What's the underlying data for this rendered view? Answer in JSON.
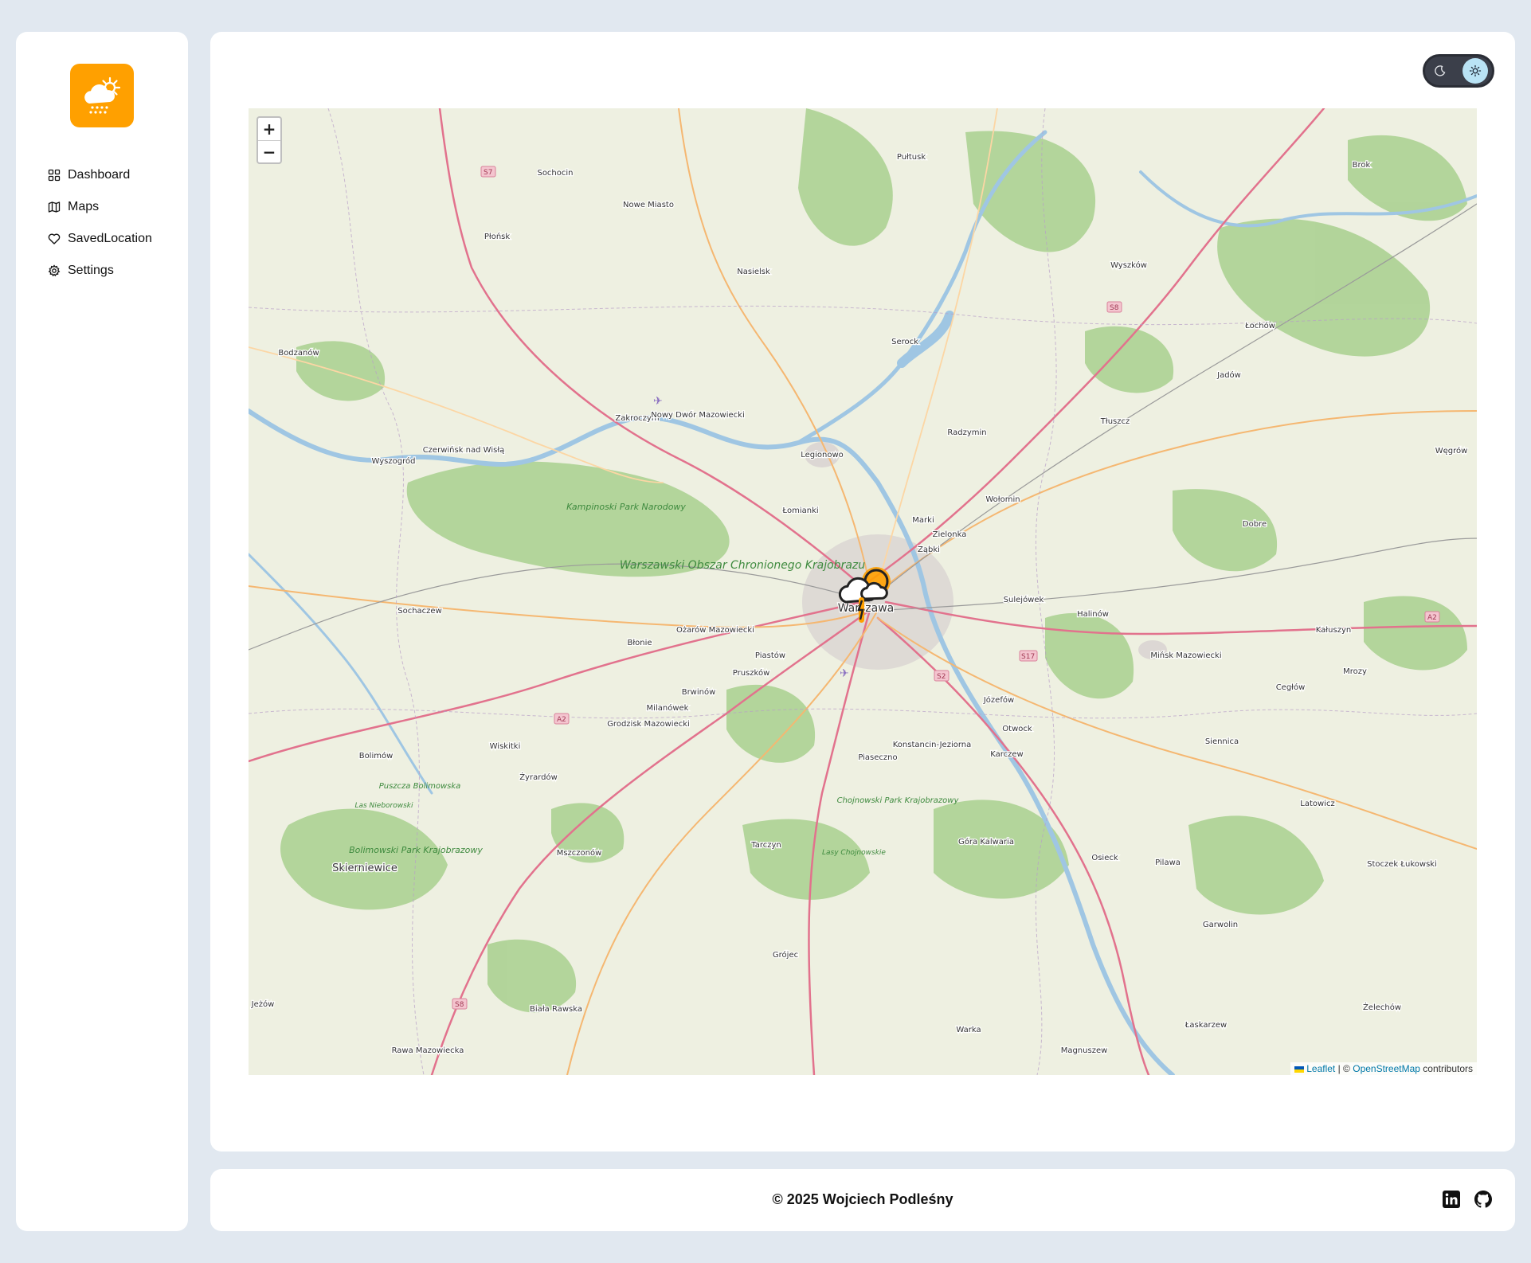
{
  "sidebar": {
    "items": [
      {
        "label": "Dashboard",
        "icon": "grid-icon"
      },
      {
        "label": "Maps",
        "icon": "map-icon"
      },
      {
        "label": "SavedLocation",
        "icon": "heart-icon"
      },
      {
        "label": "Settings",
        "icon": "gear-icon"
      }
    ]
  },
  "map": {
    "zoom_in": "+",
    "zoom_out": "−",
    "attribution": {
      "leaflet": "Leaflet",
      "separator": "| ©",
      "osm": "OpenStreetMap",
      "suffix": "contributors"
    },
    "places": [
      "Pułtusk",
      "Sochocin",
      "Nowe Miasto",
      "Płońsk",
      "Nasielsk",
      "Wyszków",
      "Brok",
      "Łochów",
      "Jadów",
      "Serock",
      "Bodzanów",
      "Zakroczym",
      "Nowy Dwór Mazowiecki",
      "Radzymin",
      "Tłuszcz",
      "Legionowo",
      "Wyszogród",
      "Czerwińsk nad Wisłą",
      "Węgrów",
      "Wołomin",
      "Łomianki",
      "Marki",
      "Zielonka",
      "Ząbki",
      "Dobre",
      "Warszawa",
      "Sochaczew",
      "Sulejówek",
      "Halinów",
      "Kałuszyn",
      "Błonie",
      "Ożarów Mazowiecki",
      "Piastów",
      "Pruszków",
      "Mińsk Mazowiecki",
      "Mrozy",
      "Brwinów",
      "Cegłów",
      "Józefów",
      "Milanówek",
      "Grodzisk Mazowiecki",
      "Otwock",
      "Konstancin-Jeziorna",
      "Piaseczno",
      "Karczew",
      "Siennica",
      "Bolimów",
      "Wiskitki",
      "Żyrardów",
      "Latowicz",
      "Mszczonów",
      "Tarczyn",
      "Góra Kalwaria",
      "Osieck",
      "Pilawa",
      "Skierniewice",
      "Stoczek Łukowski",
      "Garwolin",
      "Grójec",
      "Jeżów",
      "Biała Rawska",
      "Żelechów",
      "Łaskarzew",
      "Warka",
      "Rawa Mazowiecka",
      "Magnuszew"
    ],
    "areas": [
      "Kampinoski Park Narodowy",
      "Warszawski Obszar Chronionego Krajobrazu",
      "Bolimowski Park Krajobrazowy",
      "Chojnowski Park Krajobrazowy",
      "Puszcza Bolimowska",
      "Las Nieborowski",
      "Lasy Chojnowskie"
    ],
    "roads": [
      "S7",
      "S8",
      "S8",
      "A2",
      "A2",
      "S2",
      "S17"
    ]
  },
  "footer": {
    "copyright": "© 2025 Wojciech Podleśny",
    "links": [
      "linkedin-icon",
      "github-icon"
    ]
  },
  "colors": {
    "accent": "#ffa000",
    "toggle_bg": "#3b3f4a",
    "toggle_knob": "#b9e3f5",
    "page_bg": "#e1e8f0"
  }
}
